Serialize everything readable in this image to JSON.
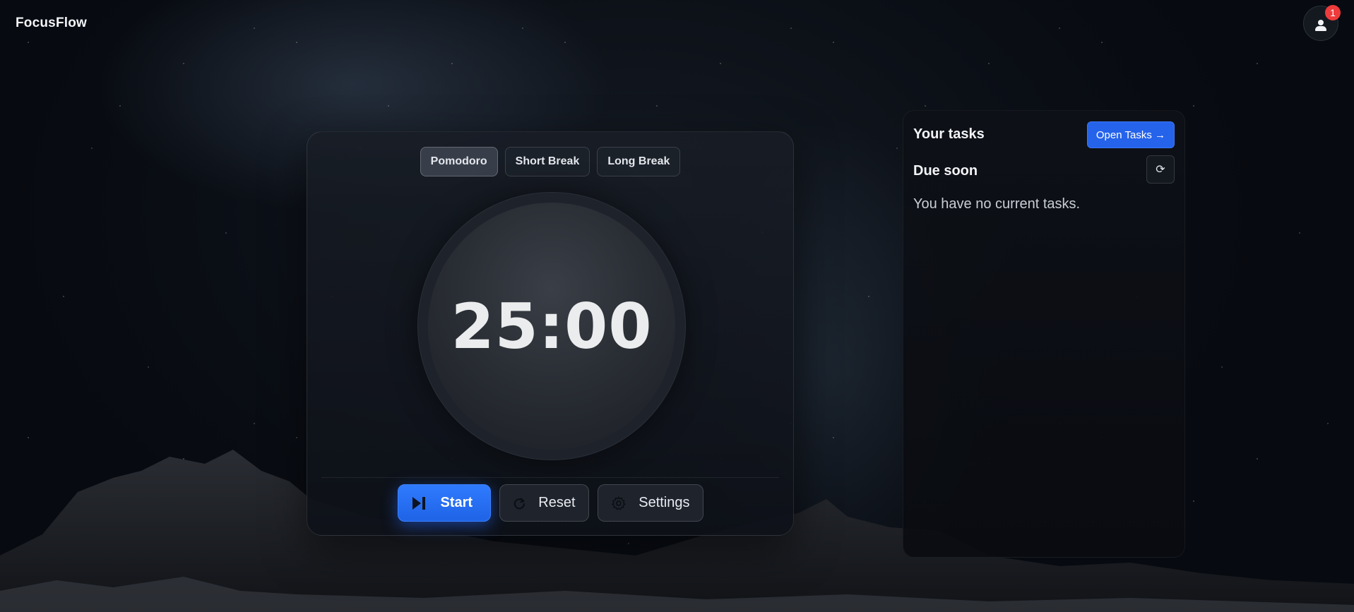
{
  "header": {
    "brand": "FocusFlow",
    "notification_count": "1"
  },
  "timer": {
    "modes": [
      {
        "label": "Pomodoro",
        "active": true
      },
      {
        "label": "Short Break",
        "active": false
      },
      {
        "label": "Long Break",
        "active": false
      }
    ],
    "time": "25:00",
    "controls": {
      "start_label": "Start",
      "reset_label": "Reset",
      "settings_label": "Settings"
    }
  },
  "tasks": {
    "title": "Your tasks",
    "open_label": "Open Tasks →",
    "due_title": "Due soon",
    "refresh_glyph": "⟳",
    "empty_message": "You have no current tasks."
  },
  "colors": {
    "accent": "#2563eb",
    "badge": "#ef3b3b"
  }
}
